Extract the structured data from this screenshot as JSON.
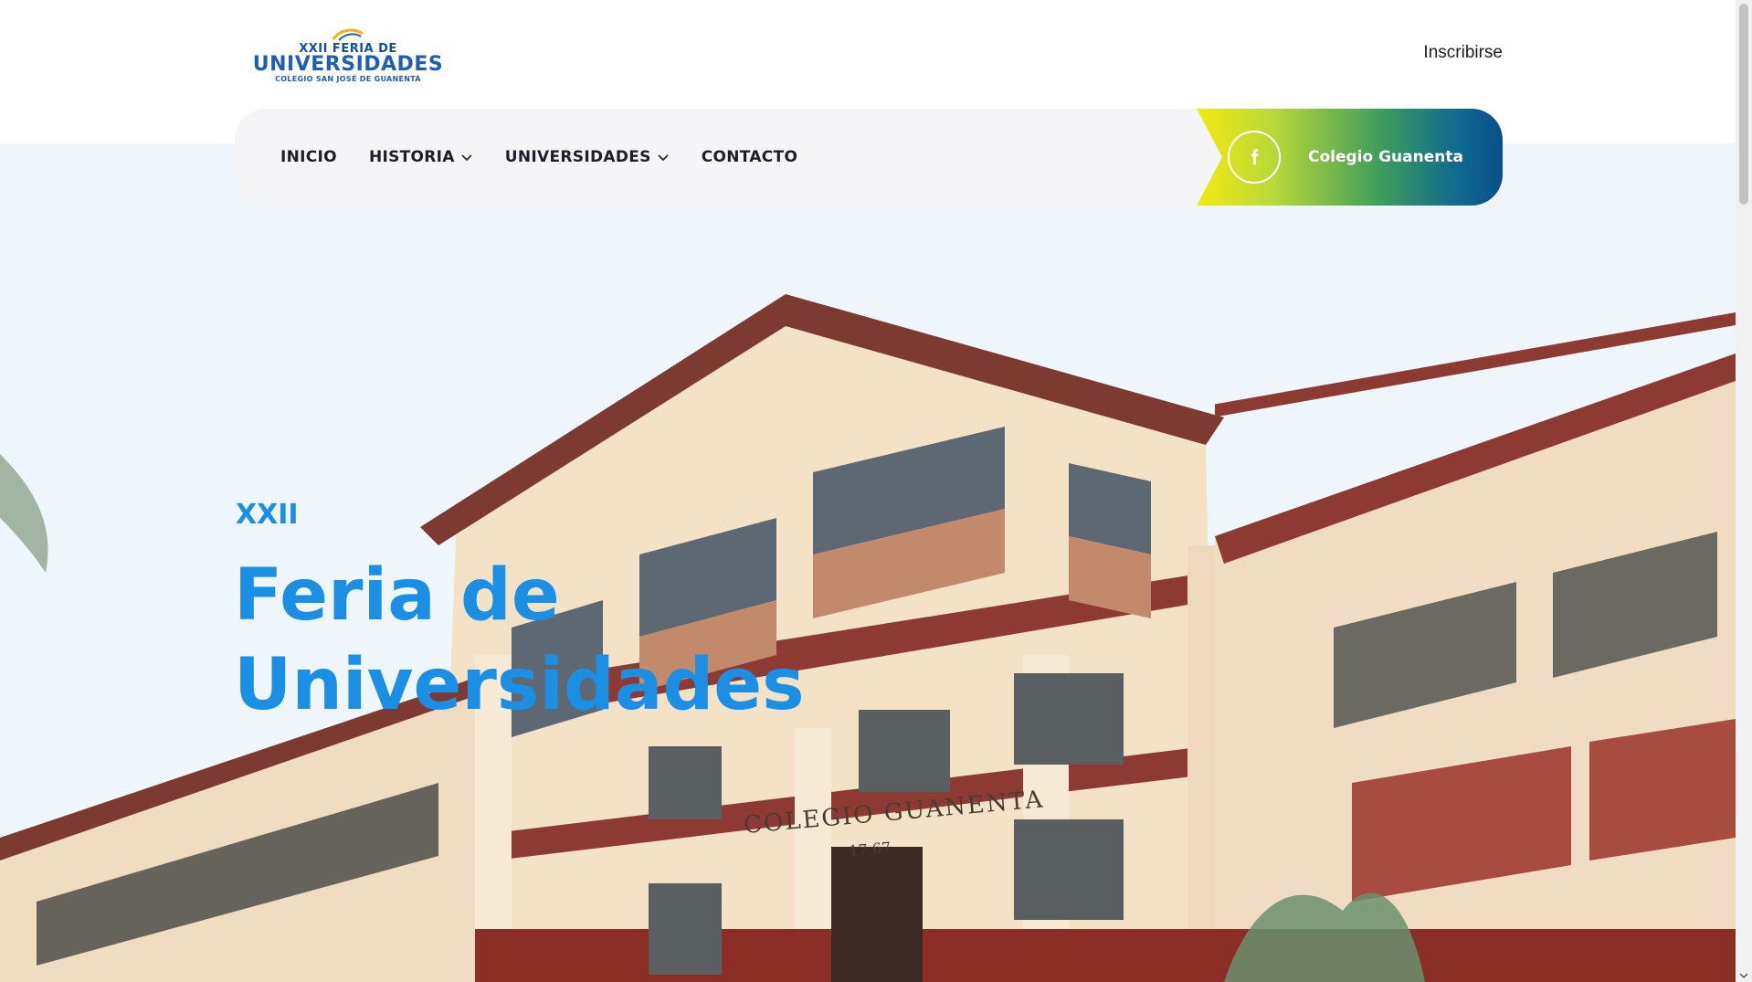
{
  "logo": {
    "line1": "XXII FERIA DE",
    "line2": "UNIVERSIDADES",
    "line3": "COLEGIO SAN JOSÉ DE GUANENTÁ"
  },
  "header": {
    "signup_label": "Inscribirse"
  },
  "nav": {
    "items": [
      {
        "label": "INICIO",
        "has_dropdown": false
      },
      {
        "label": "HISTORIA",
        "has_dropdown": true
      },
      {
        "label": "UNIVERSIDADES",
        "has_dropdown": true
      },
      {
        "label": "CONTACTO",
        "has_dropdown": false
      }
    ],
    "facebook": {
      "icon": "facebook-icon",
      "label": "Colegio Guanenta"
    }
  },
  "hero": {
    "kicker": "XXII",
    "title_line1": "Feria de",
    "title_line2": "Universidades",
    "image_sign": "COLEGIO GUANENTA",
    "image_sign_sub": "17 67"
  },
  "colors": {
    "accent_blue": "#1a8fe3",
    "nav_text": "#1e1e2a",
    "nav_bg": "#f5f5f8",
    "gradient_start": "#f2ea10",
    "gradient_end": "#0b4f8c"
  }
}
